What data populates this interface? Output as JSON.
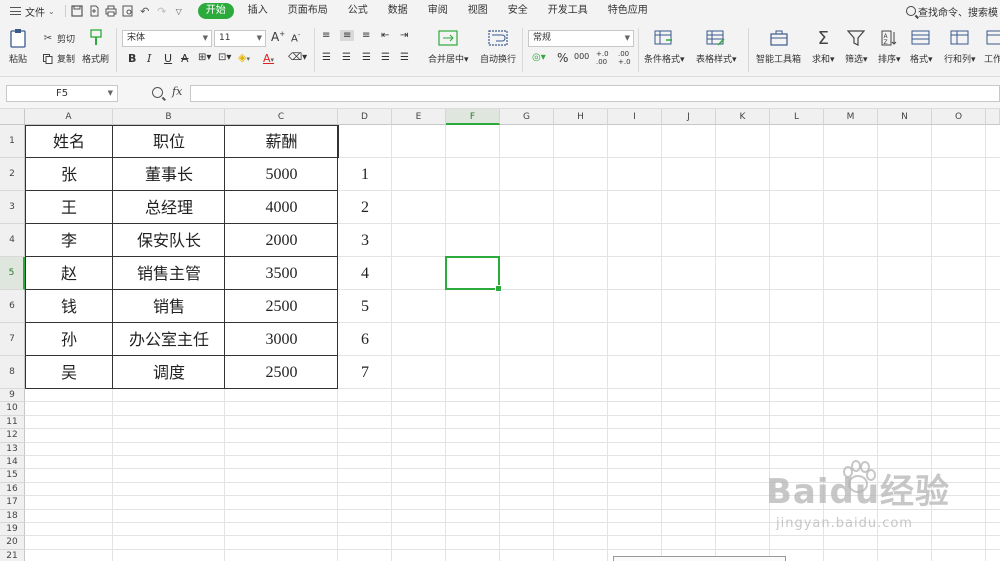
{
  "menu": {
    "file_label": "文件",
    "tabs": [
      "开始",
      "插入",
      "页面布局",
      "公式",
      "数据",
      "审阅",
      "视图",
      "安全",
      "开发工具",
      "特色应用"
    ],
    "active_tab": "开始",
    "search_text": "查找命令、搜索模"
  },
  "ribbon": {
    "paste": "粘贴",
    "cut": "剪切",
    "copy": "复制",
    "format_painter": "格式刷",
    "font_name": "宋体",
    "font_size": "11",
    "merge_center": "合并居中",
    "wrap_text": "自动换行",
    "number_format": "常规",
    "conditional_format": "条件格式",
    "table_style": "表格样式",
    "smart_toolbox": "智能工具箱",
    "sum": "求和",
    "filter": "筛选",
    "sort": "排序",
    "format": "格式",
    "rows_cols": "行和列",
    "worksheet": "工作",
    "percent": "%",
    "thousands": "000",
    "inc_decimal": "+.0 .00",
    "dec_decimal": ".00 +.0"
  },
  "formula_bar": {
    "cell_ref": "F5",
    "fx_label": "fx",
    "formula": ""
  },
  "grid": {
    "columns": [
      "A",
      "B",
      "C",
      "D",
      "E",
      "F",
      "G",
      "H",
      "I",
      "J",
      "K",
      "L",
      "M",
      "N",
      "O"
    ],
    "rows": [
      "1",
      "2",
      "3",
      "4",
      "5",
      "6",
      "7",
      "8",
      "9",
      "10",
      "11",
      "12",
      "13",
      "14",
      "15",
      "16",
      "17",
      "18",
      "19",
      "20",
      "21"
    ],
    "selected_cell": "F5",
    "header": [
      "姓名",
      "职位",
      "薪酬"
    ],
    "records": [
      {
        "name": "张",
        "position": "董事长",
        "salary": "5000",
        "d": "1"
      },
      {
        "name": "王",
        "position": "总经理",
        "salary": "4000",
        "d": "2"
      },
      {
        "name": "李",
        "position": "保安队长",
        "salary": "2000",
        "d": "3"
      },
      {
        "name": "赵",
        "position": "销售主管",
        "salary": "3500",
        "d": "4"
      },
      {
        "name": "钱",
        "position": "销售",
        "salary": "2500",
        "d": "5"
      },
      {
        "name": "孙",
        "position": "办公室主任",
        "salary": "3000",
        "d": "6"
      },
      {
        "name": "吴",
        "position": "调度",
        "salary": "2500",
        "d": "7"
      }
    ]
  },
  "watermark": {
    "brand": "Baidu经验",
    "url": "jingyan.baidu.com"
  }
}
